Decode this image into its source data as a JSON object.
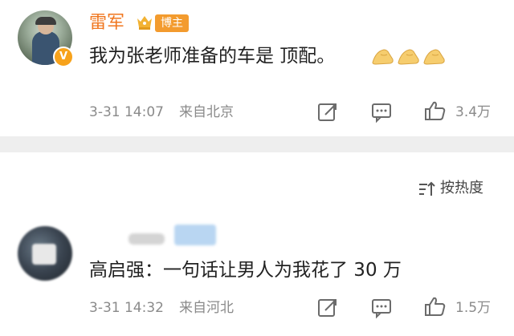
{
  "post": {
    "username": "雷军",
    "badge_label": "博主",
    "verified_mark": "V",
    "text": "我为张老师准备的车是 顶配。",
    "emoji_icons": [
      "pinching-hand-emoji",
      "pinching-hand-emoji",
      "pinching-hand-emoji"
    ],
    "date": "3-31 14:07",
    "location": "来自北京",
    "like_count": "3.4万",
    "name_color": "#f0761e"
  },
  "sort": {
    "label": "按热度"
  },
  "comment": {
    "text": "高启强：一句话让男人为我花了 30 万",
    "date": "3-31 14:32",
    "location": "来自河北",
    "like_count": "1.5万"
  }
}
